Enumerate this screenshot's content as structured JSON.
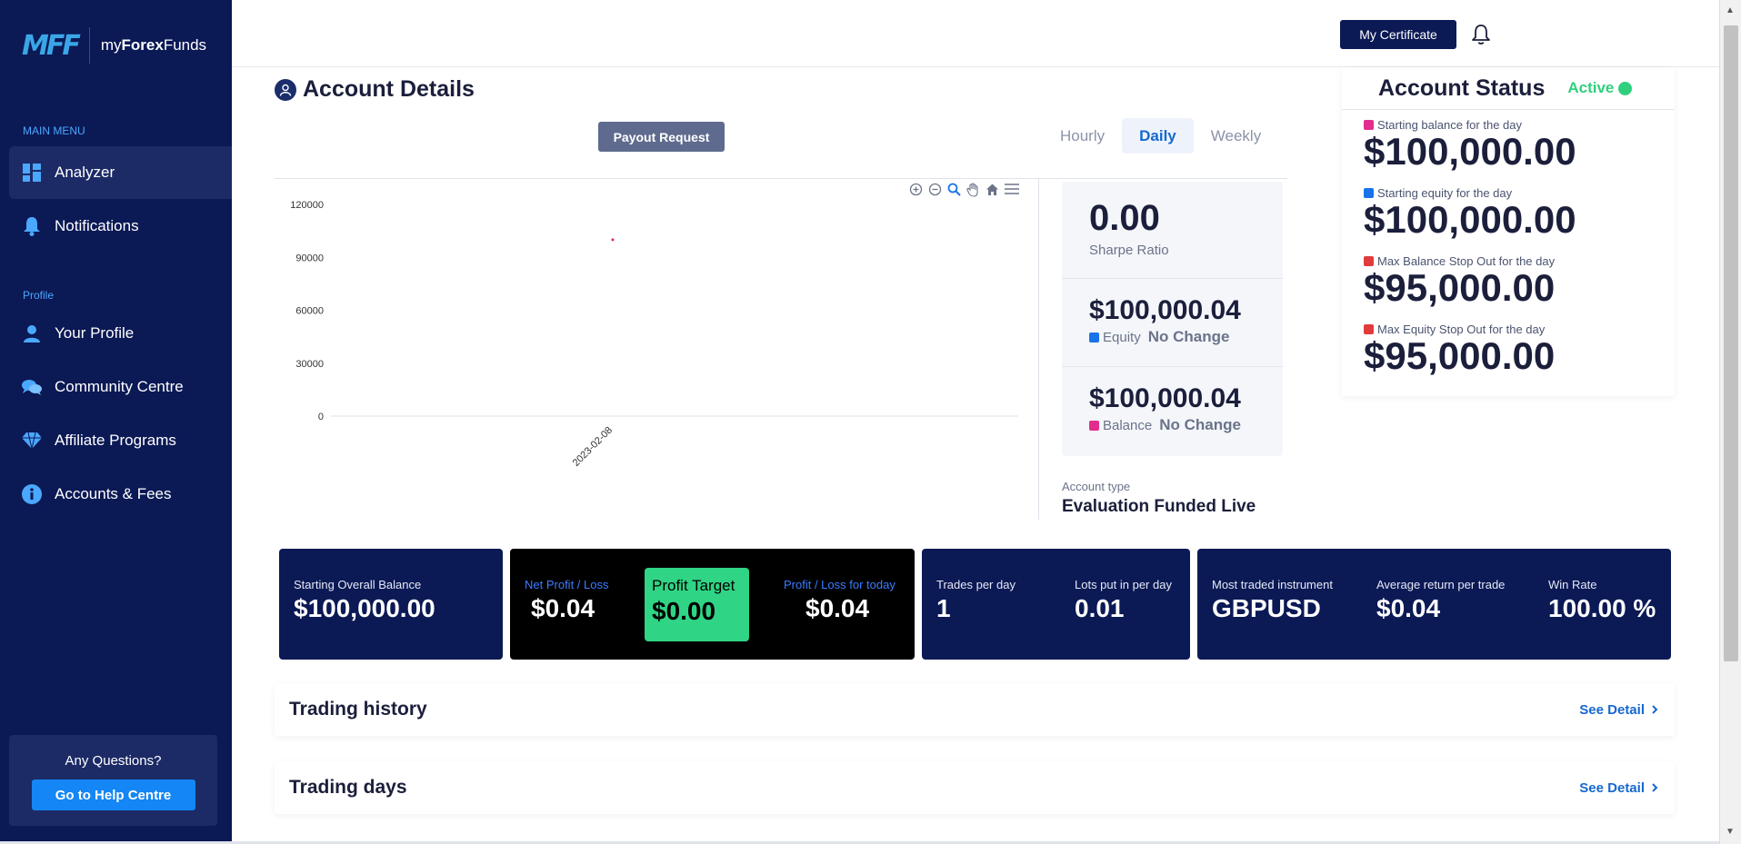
{
  "brand": {
    "mark": "MFF",
    "name_prefix": "my",
    "name_bold": "Forex",
    "name_suffix": "Funds"
  },
  "sidebar": {
    "main_heading": "MAIN MENU",
    "profile_heading": "Profile",
    "items": [
      {
        "label": "Analyzer",
        "icon": "grid-icon"
      },
      {
        "label": "Notifications",
        "icon": "bell-icon"
      },
      {
        "label": "Your Profile",
        "icon": "user-icon"
      },
      {
        "label": "Community Centre",
        "icon": "chat-icon"
      },
      {
        "label": "Affiliate Programs",
        "icon": "diamond-icon"
      },
      {
        "label": "Accounts & Fees",
        "icon": "info-icon"
      }
    ],
    "help": {
      "title": "Any Questions?",
      "button": "Go to Help Centre"
    }
  },
  "topbar": {
    "certificate_button": "My Certificate"
  },
  "account_details": {
    "title": "Account Details",
    "payout_button": "Payout Request",
    "tabs": [
      "Hourly",
      "Daily",
      "Weekly"
    ],
    "active_tab": "Daily"
  },
  "chart_data": {
    "type": "scatter",
    "x": [
      "2023-02-08"
    ],
    "values": [
      100000
    ],
    "yticks": [
      "120000",
      "90000",
      "60000",
      "30000",
      "0"
    ],
    "ylim": [
      0,
      120000
    ],
    "grid": false,
    "color": "#e02b5a"
  },
  "stats": {
    "sharpe_value": "0.00",
    "sharpe_label": "Sharpe Ratio",
    "equity_value": "$100,000.04",
    "equity_label": "Equity",
    "equity_change": "No Change",
    "balance_value": "$100,000.04",
    "balance_label": "Balance",
    "balance_change": "No Change",
    "account_type_label": "Account type",
    "account_type_value": "Evaluation Funded Live"
  },
  "account_status": {
    "title": "Account Status",
    "status": "Active",
    "rows": [
      {
        "label": "Starting balance for the day",
        "value": "$100,000.00",
        "color": "#e22d8e"
      },
      {
        "label": "Starting equity for the day",
        "value": "$100,000.00",
        "color": "#1a73e8"
      },
      {
        "label": "Max Balance Stop Out for the day",
        "value": "$95,000.00",
        "color": "#e23b3b"
      },
      {
        "label": "Max Equity Stop Out for the day",
        "value": "$95,000.00",
        "color": "#e23b3b"
      }
    ]
  },
  "summary": {
    "starting_balance_label": "Starting Overall Balance",
    "starting_balance_value": "$100,000.00",
    "net_pl_label": "Net Profit / Loss",
    "net_pl_value": "$0.04",
    "profit_target_label": "Profit Target",
    "profit_target_value": "$0.00",
    "pl_today_label": "Profit / Loss for today",
    "pl_today_value": "$0.04",
    "trades_label": "Trades per day",
    "trades_value": "1",
    "lots_label": "Lots put in per day",
    "lots_value": "0.01",
    "instrument_label": "Most traded instrument",
    "instrument_value": "GBPUSD",
    "avg_return_label": "Average return per trade",
    "avg_return_value": "$0.04",
    "win_rate_label": "Win Rate",
    "win_rate_value": "100.00 %"
  },
  "sections": [
    {
      "title": "Trading history",
      "link": "See Detail"
    },
    {
      "title": "Trading days",
      "link": "See Detail"
    }
  ]
}
